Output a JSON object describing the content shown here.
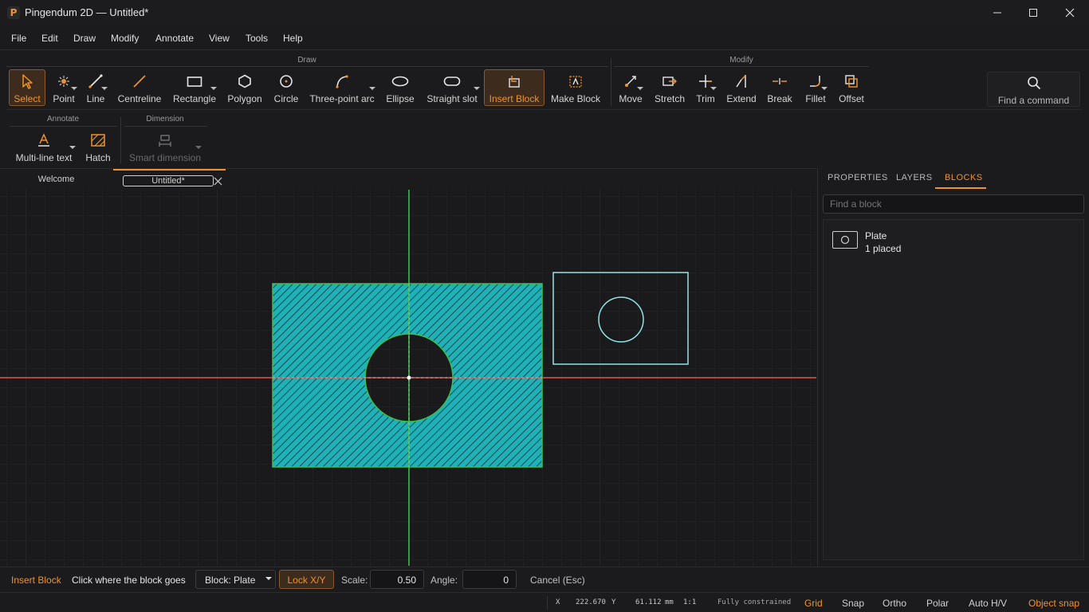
{
  "window": {
    "title": "Pingendum 2D — Untitled*",
    "logo_letter": "P"
  },
  "menu": [
    "File",
    "Edit",
    "Draw",
    "Modify",
    "Annotate",
    "View",
    "Tools",
    "Help"
  ],
  "ribbon": {
    "draw_group": "Draw",
    "modify_group": "Modify",
    "annotate_group": "Annotate",
    "dimension_group": "Dimension",
    "tools": {
      "select": "Select",
      "point": "Point",
      "line": "Line",
      "centreline": "Centreline",
      "rectangle": "Rectangle",
      "polygon": "Polygon",
      "circle": "Circle",
      "three_point_arc": "Three-point arc",
      "ellipse": "Ellipse",
      "straight_slot": "Straight slot",
      "insert_block": "Insert Block",
      "make_block": "Make Block",
      "move": "Move",
      "stretch": "Stretch",
      "trim": "Trim",
      "extend": "Extend",
      "break": "Break",
      "fillet": "Fillet",
      "offset": "Offset",
      "multiline_text": "Multi-line text",
      "hatch": "Hatch",
      "smart_dimension": "Smart dimension"
    },
    "find_command": "Find a command",
    "active_tool": "Insert Block"
  },
  "doc_tabs": [
    {
      "label": "Welcome"
    },
    {
      "label": "Untitled*"
    }
  ],
  "panel": {
    "tabs": [
      "PROPERTIES",
      "LAYERS",
      "BLOCKS"
    ],
    "active_tab": "BLOCKS",
    "search_placeholder": "Find a block",
    "blocks": [
      {
        "name": "Plate",
        "count": "1 placed"
      }
    ]
  },
  "command_bar": {
    "command": "Insert Block",
    "prompt": "Click where the block goes",
    "block_select": "Block: Plate",
    "lock": "Lock X/Y",
    "scale_label": "Scale:",
    "scale_value": "0.50",
    "angle_label": "Angle:",
    "angle_value": "0",
    "cancel": "Cancel (Esc)"
  },
  "status": {
    "x_label": "X",
    "x_value": "222.670",
    "y_label": "Y",
    "y_value": "61.112",
    "unit": "mm",
    "scale": "1:1",
    "constraint": "Fully constrained",
    "toggles": [
      {
        "label": "Grid",
        "on": true
      },
      {
        "label": "Snap",
        "on": false
      },
      {
        "label": "Ortho",
        "on": false
      },
      {
        "label": "Polar",
        "on": false
      },
      {
        "label": "Auto H/V",
        "on": false
      },
      {
        "label": "Object snap",
        "on": true
      }
    ]
  },
  "colors": {
    "accent": "#f0922b",
    "x_axis": "#e0584a",
    "y_axis": "#3fbf4a",
    "hatch": "#1fb1b8",
    "preview": "#8fe3e6"
  }
}
